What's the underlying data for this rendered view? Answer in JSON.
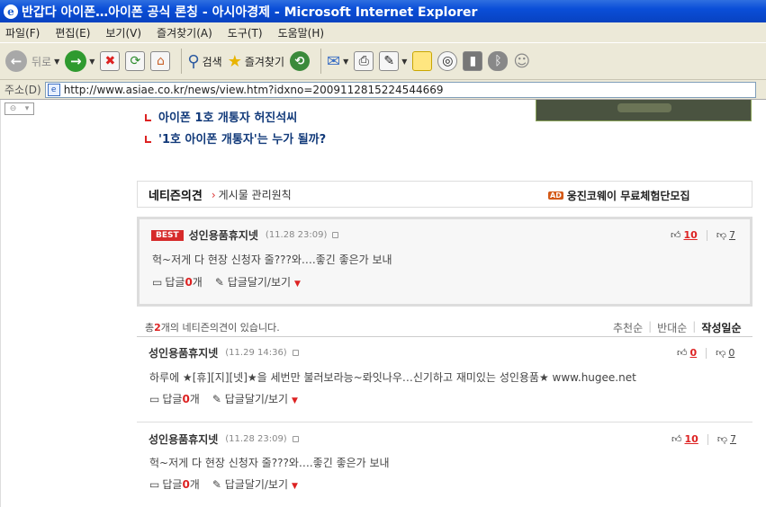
{
  "window": {
    "title": "반갑다 아이폰…아이폰 공식 론칭 - 아시아경제 - Microsoft Internet Explorer"
  },
  "menu": [
    "파일(F)",
    "편집(E)",
    "보기(V)",
    "즐겨찾기(A)",
    "도구(T)",
    "도움말(H)"
  ],
  "toolbar": {
    "back": "뒤로",
    "search": "검색",
    "favorites": "즐겨찾기"
  },
  "address": {
    "label": "주소(D)",
    "url": "http://www.asiae.co.kr/news/view.htm?idxno=2009112815224544669"
  },
  "related": [
    "아이폰 1호 개통자 허진석씨",
    "'1호 아이폰 개통자'는 누가 될까?"
  ],
  "netizen": {
    "title": "네티즌의견",
    "rules": "게시물 관리원칙",
    "ad_badge": "AD",
    "ad_text": "웅진코웨이 무료체험단모집"
  },
  "best_comment": {
    "badge": "BEST",
    "user": "성인용품휴지넷",
    "date": "(11.28 23:09)",
    "up": "10",
    "down": "7",
    "text": "헉~저게 다 현장 신청자 줄???와….좋긴 좋은가 보내",
    "reply_label": "답글",
    "reply_count": "0",
    "reply_suffix": "개",
    "reply_action": "답글달기/보기"
  },
  "summary": {
    "prefix": "총",
    "count": "2",
    "suffix": "개의 네티즌의견이 있습니다."
  },
  "sort": [
    "추천순",
    "반대순",
    "작성일순"
  ],
  "comments": [
    {
      "user": "성인용품휴지넷",
      "date": "(11.29 14:36)",
      "up": "0",
      "down": "0",
      "text": "하루에 ★[휴][지][넷]★을 세번만 불러보라능~롸잇나우…신기하고 재미있는 성인용품★ www.hugee.net",
      "reply_label": "답글",
      "reply_count": "0",
      "reply_suffix": "개",
      "reply_action": "답글달기/보기"
    },
    {
      "user": "성인용품휴지넷",
      "date": "(11.28 23:09)",
      "up": "10",
      "down": "7",
      "text": "헉~저게 다 현장 신청자 줄???와….좋긴 좋은가 보내",
      "reply_label": "답글",
      "reply_count": "0",
      "reply_suffix": "개",
      "reply_action": "답글달기/보기"
    }
  ]
}
